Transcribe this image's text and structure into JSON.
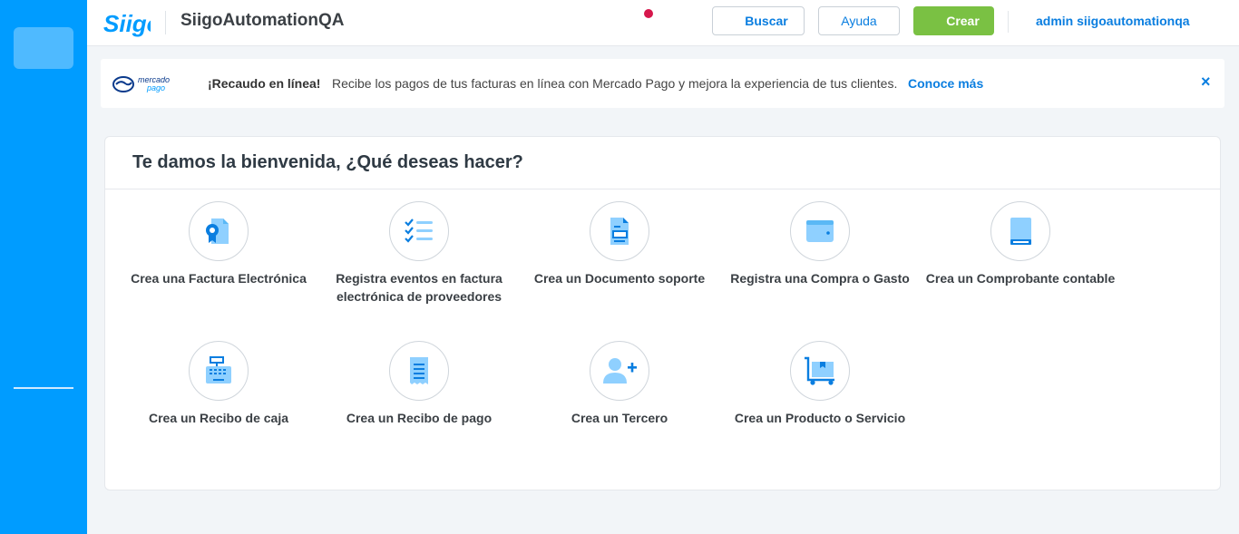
{
  "topbar": {
    "brand": "Siigo",
    "company": "SiigoAutomationQA",
    "search_label": "Buscar",
    "help_label": "Ayuda",
    "create_label": "Crear",
    "user": "admin siigoautomationqa"
  },
  "banner": {
    "logo_text_1": "mercado",
    "logo_text_2": "pago",
    "title": "¡Recaudo en línea!",
    "text": "Recibe los pagos de tus facturas en línea con Mercado Pago y mejora la experiencia de tus clientes.",
    "link": "Conoce más",
    "close": "×"
  },
  "welcome": {
    "title": "Te damos la bienvenida, ¿Qué deseas hacer?",
    "actions": [
      {
        "label": "Crea una Factura Electrónica",
        "icon": "invoice-icon"
      },
      {
        "label": "Registra eventos en factura electrónica de proveedores",
        "icon": "checklist-icon"
      },
      {
        "label": "Crea un Documento soporte",
        "icon": "document-icon"
      },
      {
        "label": "Registra una Compra o Gasto",
        "icon": "wallet-icon"
      },
      {
        "label": "Crea un Comprobante contable",
        "icon": "ledger-book-icon"
      },
      {
        "label": "Crea un Recibo de caja",
        "icon": "cash-register-icon"
      },
      {
        "label": "Crea un Recibo de pago",
        "icon": "receipt-icon"
      },
      {
        "label": "Crea un Tercero",
        "icon": "add-person-icon"
      },
      {
        "label": "Crea un Producto o Servicio",
        "icon": "product-cart-icon"
      }
    ]
  },
  "colors": {
    "sidebar": "#009cff",
    "primary": "#0a7ee0",
    "create": "#7ac143",
    "icon_light": "#8fd0ff",
    "icon_dark": "#0a7ee0"
  }
}
